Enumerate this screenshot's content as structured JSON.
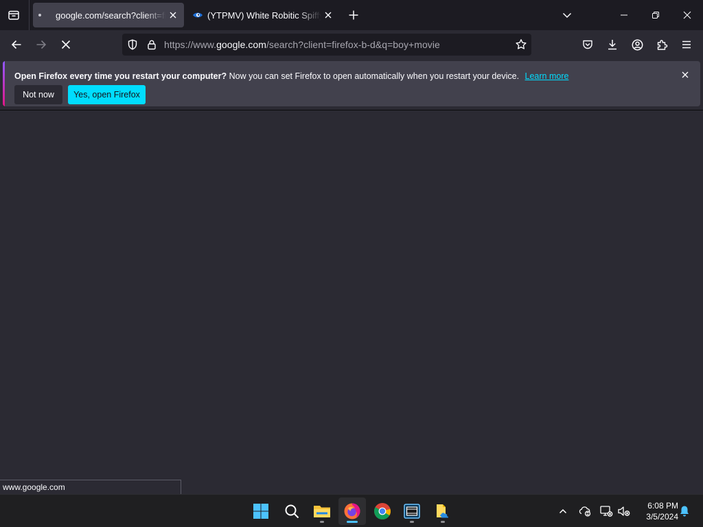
{
  "tabs": [
    {
      "title": "google.com/search?client=firefox-b-d&q=boy+movie",
      "loading": true,
      "active": true
    },
    {
      "title": "(YTPMV) White Robitic Spiffy Song",
      "favicon": "eye-favicon-icon",
      "active": false
    }
  ],
  "navbar": {
    "url_prefix": "https://www.",
    "url_host": "google.com",
    "url_rest": "/search?client=firefox-b-d&q=boy+movie"
  },
  "notification": {
    "title": "Open Firefox every time you restart your computer?",
    "body": "Now you can set Firefox to open automatically when you restart your device.",
    "link": "Learn more",
    "secondary_button": "Not now",
    "primary_button": "Yes, open Firefox"
  },
  "status_text": "www.google.com",
  "taskbar": {
    "apps": [
      "start-icon",
      "search-icon",
      "file-explorer-icon",
      "firefox-icon",
      "chrome-icon",
      "media-app-icon",
      "files-cloud-icon"
    ],
    "time": "6:08 PM",
    "date": "3/5/2024"
  },
  "colors": {
    "accent": "#00ddff",
    "toolbar": "#2b2a33",
    "tabstrip": "#1c1b22",
    "taskbar": "#1f1f21",
    "taskbar_active": "#4cc2ff"
  }
}
